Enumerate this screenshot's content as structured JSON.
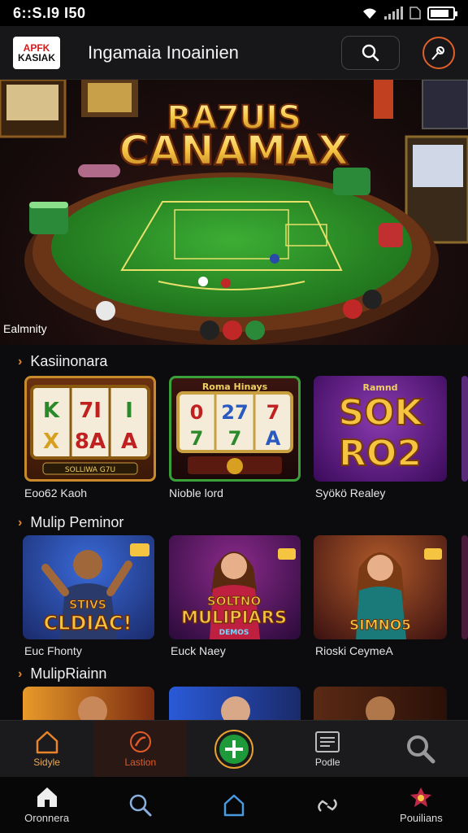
{
  "status": {
    "time": "6::S.I9 I50"
  },
  "header": {
    "logo_top": "APFK",
    "logo_bottom": "KASIAK",
    "title": "Ingamaia Inoainien",
    "search_icon": "search-icon",
    "profile_icon": "pin-icon"
  },
  "hero": {
    "banner_line1": "RA7UIS",
    "banner_line2": "CANAMAX",
    "caption": "Ealmnity"
  },
  "sections": [
    {
      "title": "Kasiinonara",
      "cards": [
        {
          "label": "Eoo62 Kaoh",
          "art": "slot-machine",
          "reels": [
            "K",
            "7I",
            "I",
            "X",
            "8A",
            "A"
          ],
          "footer": "SOLLIWA  G7U"
        },
        {
          "label": "Nioble lord",
          "art": "slot-machine",
          "banner": "Roma Hinays",
          "reels": [
            "0",
            "27",
            "7",
            "7",
            "7",
            "A"
          ]
        },
        {
          "label": "Syökö Realey",
          "art": "text-art",
          "line1": "SOK",
          "line2": "RO2",
          "banner": "Ramnd"
        }
      ]
    },
    {
      "title": "Mulip Peminor",
      "cards": [
        {
          "label": "Euc Fhonty",
          "art": "character",
          "text1": "STIVS",
          "text2": "CLDIAC!"
        },
        {
          "label": "Euck Naey",
          "art": "character",
          "text1": "SOLTNO",
          "text2": "MULIPIARS",
          "text3": "DEMOS"
        },
        {
          "label": "Rioski CeymeA",
          "art": "character",
          "text1": "SIMNO5"
        }
      ]
    },
    {
      "title": "MulipRiainn",
      "cards": [
        {
          "art": "character"
        },
        {
          "art": "character"
        },
        {
          "art": "character"
        }
      ]
    }
  ],
  "nav_top": [
    {
      "label": "Sidyle",
      "icon": "home-icon"
    },
    {
      "label": "Lastion",
      "icon": "chili-icon"
    },
    {
      "label": "",
      "icon": "plus-icon"
    },
    {
      "label": "Podle",
      "icon": "list-icon"
    },
    {
      "label": "",
      "icon": "search-icon"
    }
  ],
  "nav_bottom": [
    {
      "label": "Oronnera",
      "icon": "home-icon"
    },
    {
      "label": "",
      "icon": "search-icon"
    },
    {
      "label": "",
      "icon": "house-outline-icon"
    },
    {
      "label": "",
      "icon": "link-icon"
    },
    {
      "label": "Pouilians",
      "icon": "star-badge-icon"
    }
  ],
  "colors": {
    "accent": "#e8842a",
    "felt": "#2f9a2a",
    "gold": "#f5c542",
    "purple": "#5a1a8a"
  }
}
